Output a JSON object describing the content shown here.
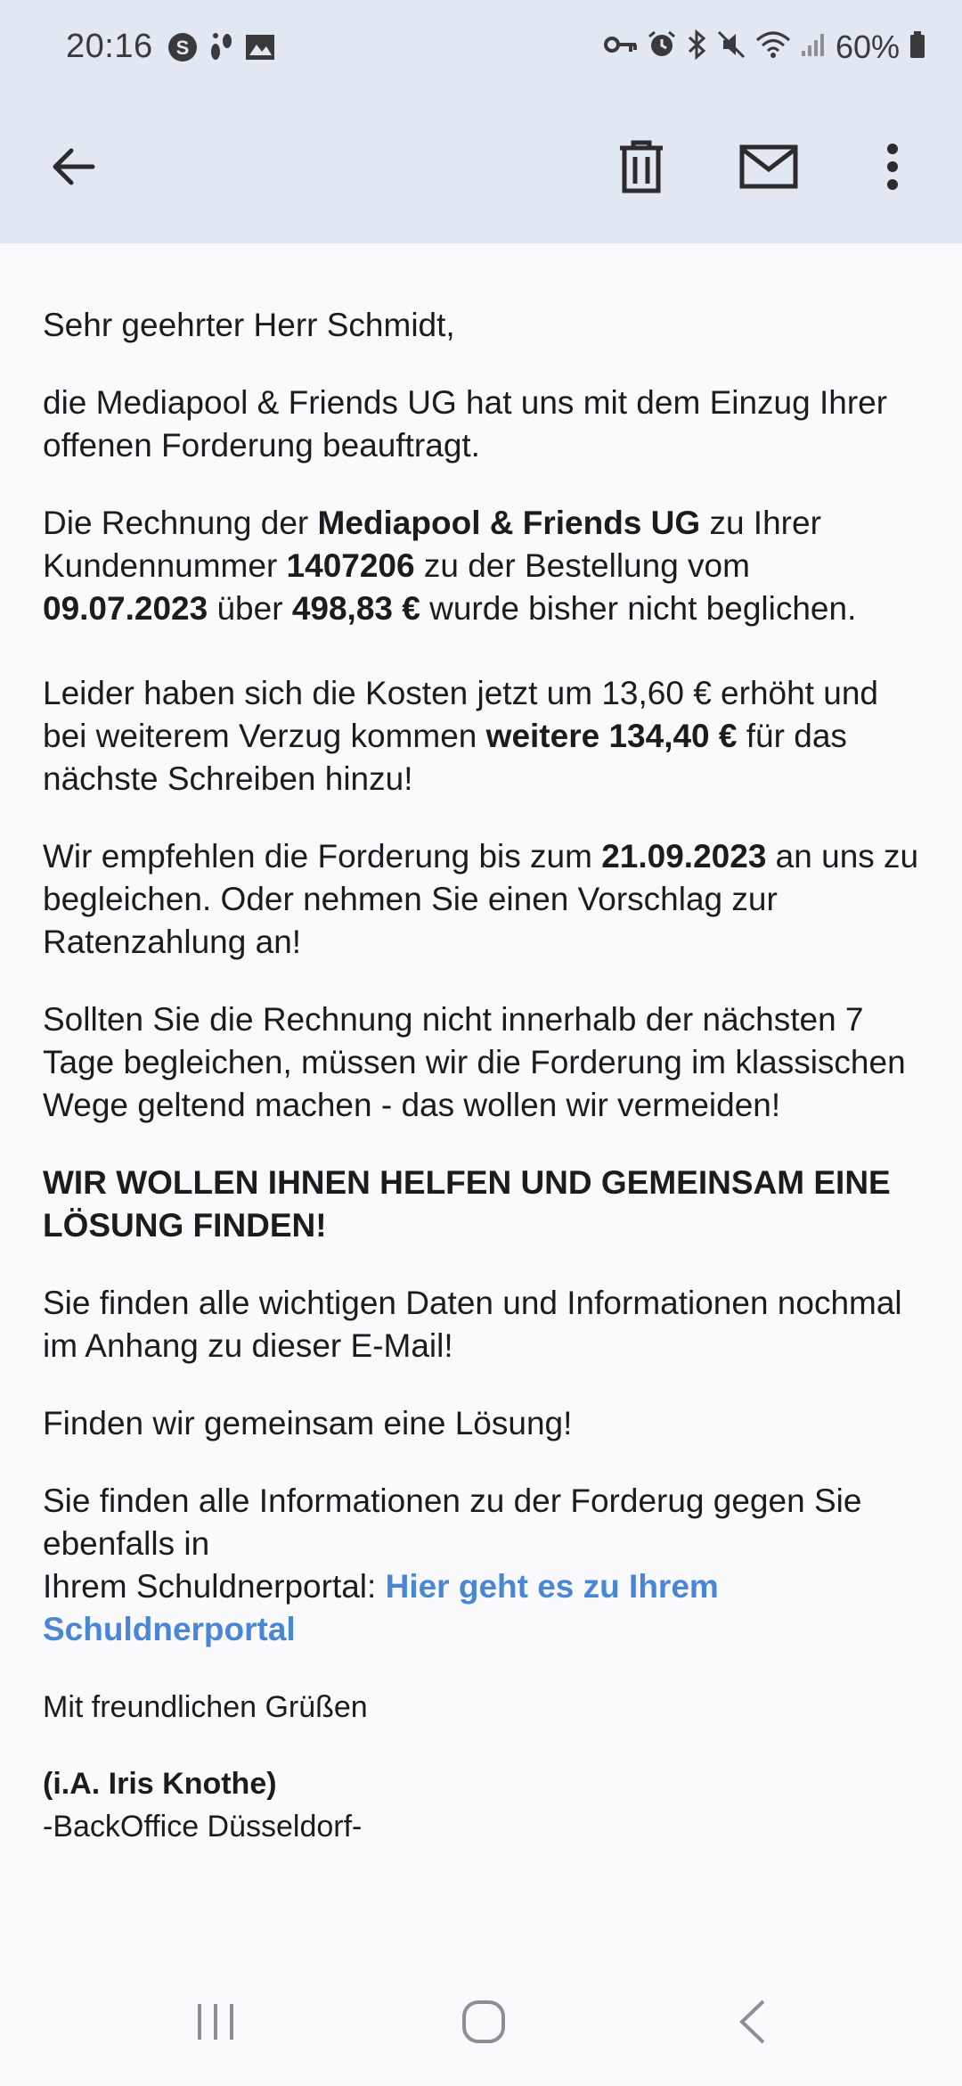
{
  "status_bar": {
    "time": "20:16",
    "battery": "60%"
  },
  "icons": {
    "back": "arrow-left-icon",
    "delete": "trash-icon",
    "mail": "envelope-icon",
    "more": "more-vert-icon"
  },
  "email": {
    "greeting": "Sehr geehrter Herr Schmidt,",
    "p1": "die Mediapool & Friends UG hat uns mit dem Einzug Ihrer offenen Forderung beauftragt.",
    "p2": {
      "t1": "Die Rechnung der ",
      "company": "Mediapool & Friends UG",
      "t2": " zu Ihrer Kundennummer ",
      "customer_no": "1407206",
      "t3": " zu der Bestellung vom ",
      "date": "09.07.2023",
      "t4": " über ",
      "amount": "498,83 €",
      "t5": " wurde bisher nicht beglichen."
    },
    "p3": {
      "t1": "Leider haben sich die Kosten jetzt um 13,60 € erhöht und bei weiterem Verzug kommen ",
      "extra": "weitere 134,40 €",
      "t2": " für das nächste Schreiben hinzu!"
    },
    "p4": {
      "t1": "Wir empfehlen die Forderung bis zum ",
      "deadline": "21.09.2023",
      "t2": " an uns zu begleichen. Oder nehmen Sie einen Vorschlag zur Ratenzahlung an!"
    },
    "p5": "Sollten Sie die Rechnung nicht innerhalb der nächsten 7 Tage begleichen, müssen wir die Forderung im klassischen Wege geltend machen - das wollen wir vermeiden!",
    "p6": "WIR WOLLEN IHNEN HELFEN UND GEMEINSAM EINE LÖSUNG FINDEN!",
    "p7": "Sie finden alle wichtigen Daten und Informationen nochmal im Anhang zu dieser E-Mail!",
    "p8": "Finden wir gemeinsam eine Lösung!",
    "p9": {
      "line1": "Sie finden alle Informationen zu der Forderug gegen Sie ebenfalls in",
      "line2": "Ihrem Schuldnerportal: ",
      "link": "Hier geht es zu Ihrem Schuldnerportal"
    },
    "closing": "Mit freundlichen Grüßen",
    "signature": "(i.A. Iris Knothe)",
    "department": "-BackOffice Düsseldorf-"
  },
  "colors": {
    "header_bg": "#e1e8f2",
    "link": "#4a86d6",
    "body_bg": "#fafafd"
  }
}
